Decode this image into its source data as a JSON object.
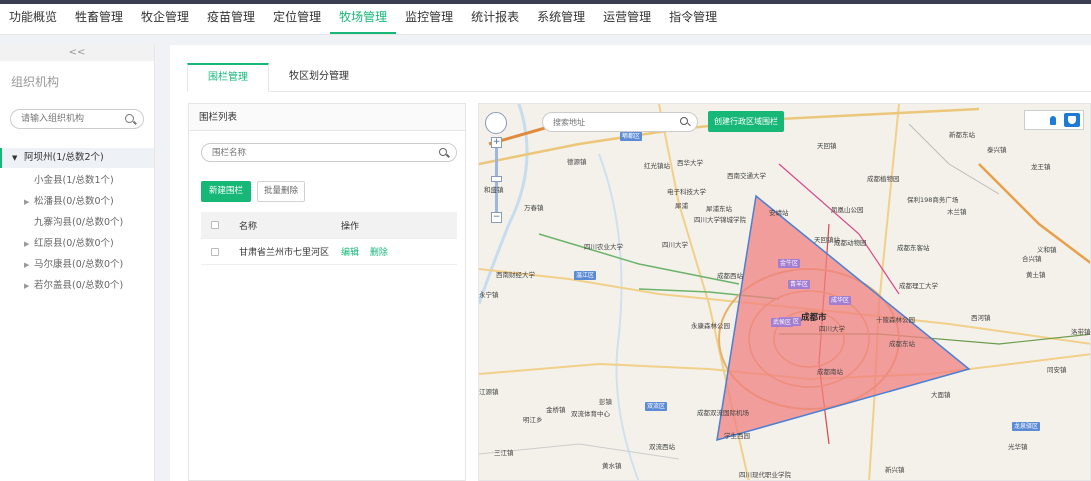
{
  "nav": {
    "items": [
      "功能概览",
      "牲畜管理",
      "牧企管理",
      "疫苗管理",
      "定位管理",
      "牧场管理",
      "监控管理",
      "统计报表",
      "系统管理",
      "运营管理",
      "指令管理"
    ],
    "active_index": 5
  },
  "sidebar": {
    "collapse": "<<",
    "title": "组织机构",
    "search_placeholder": "请输入组织机构",
    "tree": [
      {
        "label": "阿坝州(1/总数2个)",
        "level": 0,
        "expanded": true
      },
      {
        "label": "小金县(1/总数1个)",
        "level": 1,
        "has_children": false
      },
      {
        "label": "松潘县(0/总数0个)",
        "level": 1,
        "has_children": true
      },
      {
        "label": "九寨沟县(0/总数0个)",
        "level": 1,
        "has_children": false
      },
      {
        "label": "红原县(0/总数0个)",
        "level": 1,
        "has_children": true
      },
      {
        "label": "马尔康县(0/总数0个)",
        "level": 1,
        "has_children": true
      },
      {
        "label": "若尔盖县(0/总数0个)",
        "level": 1,
        "has_children": true
      }
    ]
  },
  "tabs": [
    "围栏管理",
    "牧区划分管理"
  ],
  "list": {
    "title": "围栏列表",
    "search_placeholder": "围栏名称",
    "new_button": "新建围栏",
    "batch_delete": "批量删除",
    "columns": [
      "名称",
      "操作"
    ],
    "rows": [
      {
        "name": "甘肃省兰州市七里河区",
        "edit": "编辑",
        "delete": "删除"
      }
    ]
  },
  "map": {
    "search_placeholder": "搜索地址",
    "create_button": "创建行政区域围栏",
    "labels": [
      "郫都区",
      "德源镇",
      "红光镇站",
      "西华大学",
      "犀浦",
      "西南交通大学",
      "天回镇",
      "成都植物园",
      "和盛镇",
      "万春镇",
      "电子科技大学",
      "四川大学锦城学院",
      "犀浦东站",
      "安靖站",
      "天回镇站",
      "凤凰山公园",
      "保利198商务广场",
      "木兰镇",
      "新都东站",
      "泰兴镇",
      "龙王镇",
      "温江区",
      "四川农业大学",
      "四川大学",
      "成都西站",
      "青羊区",
      "金牛区",
      "成都动物园",
      "成都东客站",
      "西南财经大学",
      "成都市",
      "锦江区",
      "成华区",
      "武侯区",
      "四川大学",
      "成都东站",
      "成都理工大学",
      "西河镇",
      "合兴镇",
      "义和镇",
      "黄土镇",
      "永宁镇",
      "永康森林公园",
      "十陵森林公园",
      "成都南站",
      "江源镇",
      "彭镇",
      "金桥镇",
      "双流区",
      "双流体育中心",
      "成都双流国际机场",
      "大面镇",
      "同安镇",
      "龙泉驿区",
      "明江乡",
      "三江镇",
      "黄水镇",
      "双流西站",
      "四川现代职业学院",
      "学生西园",
      "新兴镇",
      "洛带镇",
      "光华镇"
    ]
  },
  "colors": {
    "accent": "#16b777",
    "polygon_fill": "#f08080",
    "polygon_stroke": "#4a7fd4"
  },
  "icons": [
    "search-icon",
    "pan-control-icon",
    "zoom-in-icon",
    "zoom-out-icon",
    "hand-tool-icon",
    "shield-tool-icon"
  ]
}
